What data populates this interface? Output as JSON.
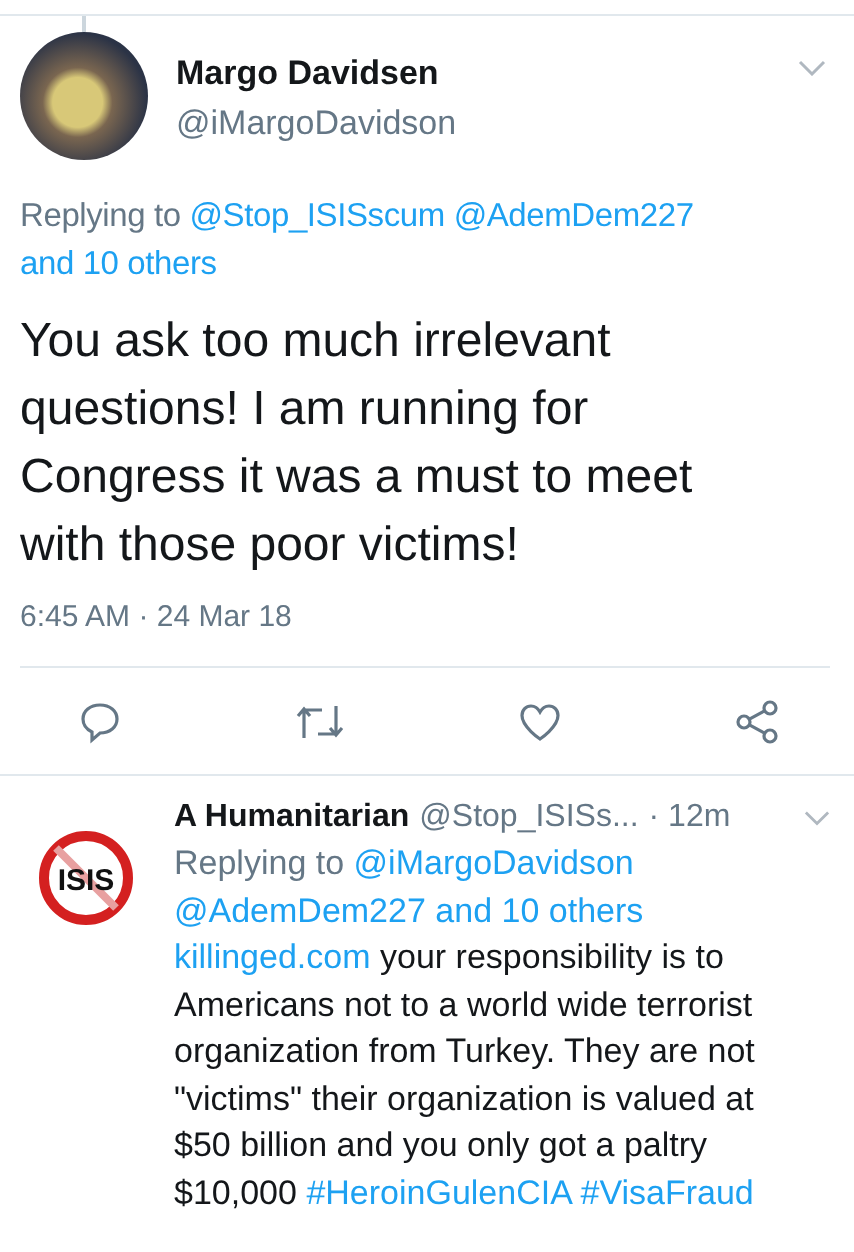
{
  "tweet": {
    "name": "Margo Davidsen",
    "handle": "@iMargoDavidson",
    "replying": [
      {
        "kind": "text",
        "text": "Replying to"
      },
      {
        "kind": "link",
        "text": "@Stop_ISISscum"
      },
      {
        "kind": "link",
        "text": "@AdemDem227"
      },
      {
        "kind": "link",
        "text": "and 10 others"
      }
    ],
    "body": "You ask too much irrelevant questions! I am running for Congress it was a must to meet with those poor victims!",
    "timestamp": "6:45 AM · 24 Mar 18"
  },
  "reply": {
    "name": "A Humanitarian",
    "handle": "@Stop_ISISs...",
    "age": "· 12m",
    "avatar_text": "ISIS",
    "replying": [
      {
        "kind": "text",
        "text": "Replying to"
      },
      {
        "kind": "link",
        "text": "@iMargoDavidson"
      },
      {
        "kind": "link",
        "text": "@AdemDem227"
      },
      {
        "kind": "link",
        "text": "and 10 others"
      }
    ],
    "body": [
      {
        "kind": "link",
        "text": "killinged.com"
      },
      {
        "kind": "text",
        "text": "your responsibility is to Americans not to a world wide terrorist organization from Turkey. They are not \"victims\" their organization is valued at $50 billion and you only got a paltry $10,000"
      },
      {
        "kind": "link",
        "text": "#HeroinGulenCIA"
      },
      {
        "kind": "link",
        "text": "#VisaFraud"
      }
    ]
  }
}
